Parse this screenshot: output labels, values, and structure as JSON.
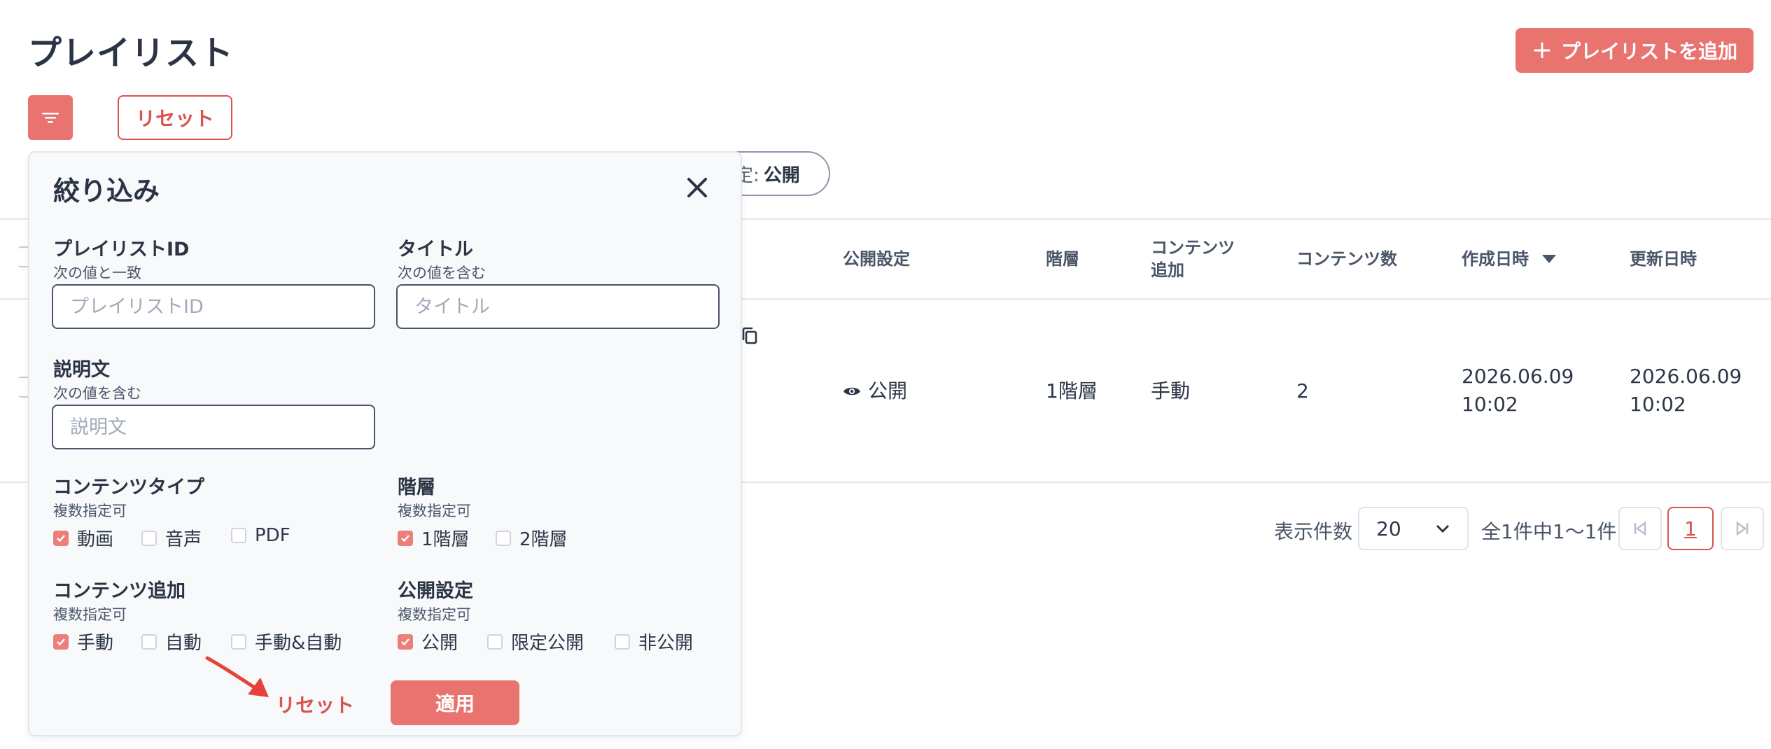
{
  "header": {
    "title": "プレイリスト",
    "add_button": "プレイリストを追加"
  },
  "toolbar": {
    "reset_label": "リセット"
  },
  "active_filter_chip": {
    "label": "定:",
    "value": "公開"
  },
  "table": {
    "headers": [
      "公開設定",
      "階層",
      "コンテンツ\n追加",
      "コンテンツ数",
      "作成日時",
      "更新日時"
    ],
    "header_content_add_line1": "コンテンツ",
    "header_content_add_line2": "追加",
    "row": {
      "visibility": "公開",
      "level": "1階層",
      "content_add": "手動",
      "content_count": "2",
      "created_date": "2026.06.09",
      "created_time": "10:02",
      "updated_date": "2026.06.09",
      "updated_time": "10:02"
    }
  },
  "pagination": {
    "per_page_label": "表示件数",
    "per_page_value": "20",
    "summary": "全1件中1〜1件",
    "current_page": "1"
  },
  "filter_panel": {
    "title": "絞り込み",
    "playlist_id": {
      "label": "プレイリストID",
      "sub": "次の値と一致",
      "placeholder": "プレイリストID"
    },
    "title_field": {
      "label": "タイトル",
      "sub": "次の値を含む",
      "placeholder": "タイトル"
    },
    "description": {
      "label": "説明文",
      "sub": "次の値を含む",
      "placeholder": "説明文"
    },
    "content_type": {
      "label": "コンテンツタイプ",
      "sub": "複数指定可",
      "options": [
        {
          "label": "動画",
          "checked": true
        },
        {
          "label": "音声",
          "checked": false
        },
        {
          "label": "PDF",
          "checked": false
        }
      ]
    },
    "level": {
      "label": "階層",
      "sub": "複数指定可",
      "options": [
        {
          "label": "1階層",
          "checked": true
        },
        {
          "label": "2階層",
          "checked": false
        }
      ]
    },
    "content_add": {
      "label": "コンテンツ追加",
      "sub": "複数指定可",
      "options": [
        {
          "label": "手動",
          "checked": true
        },
        {
          "label": "自動",
          "checked": false
        },
        {
          "label": "手動&自動",
          "checked": false
        }
      ]
    },
    "visibility": {
      "label": "公開設定",
      "sub": "複数指定可",
      "options": [
        {
          "label": "公開",
          "checked": true
        },
        {
          "label": "限定公開",
          "checked": false
        },
        {
          "label": "非公開",
          "checked": false
        }
      ]
    },
    "reset_label": "リセット",
    "apply_label": "適用"
  },
  "colors": {
    "accent": "#e8736f",
    "danger": "#d9534f",
    "annotation_arrow": "#e8403a"
  }
}
